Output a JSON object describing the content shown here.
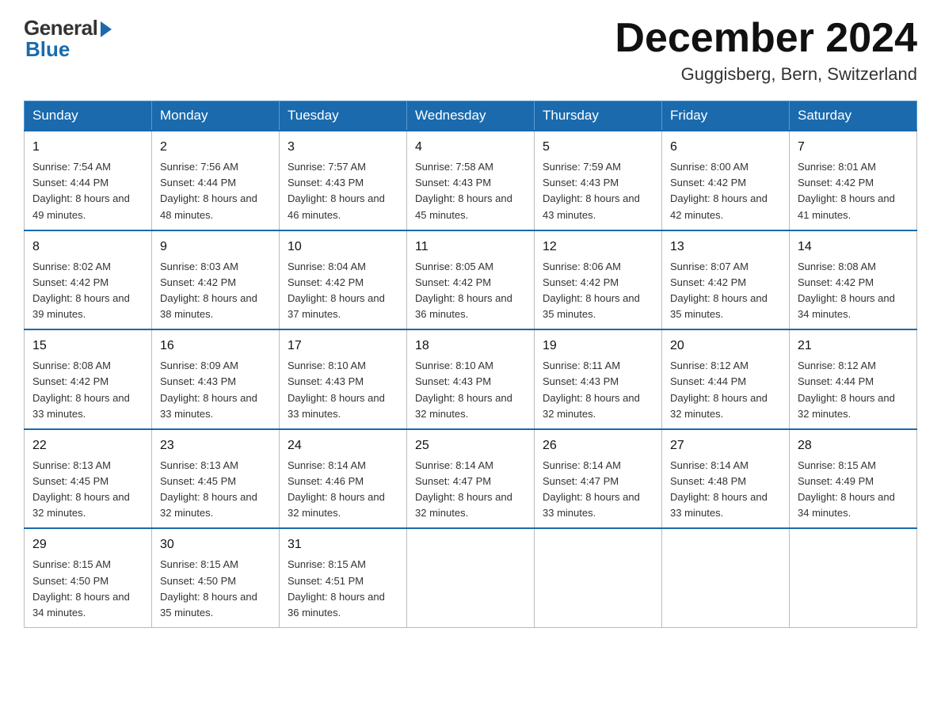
{
  "logo": {
    "general": "General",
    "blue": "Blue"
  },
  "title": {
    "month": "December 2024",
    "location": "Guggisberg, Bern, Switzerland"
  },
  "headers": [
    "Sunday",
    "Monday",
    "Tuesday",
    "Wednesday",
    "Thursday",
    "Friday",
    "Saturday"
  ],
  "weeks": [
    [
      {
        "day": "1",
        "sunrise": "7:54 AM",
        "sunset": "4:44 PM",
        "daylight": "8 hours and 49 minutes."
      },
      {
        "day": "2",
        "sunrise": "7:56 AM",
        "sunset": "4:44 PM",
        "daylight": "8 hours and 48 minutes."
      },
      {
        "day": "3",
        "sunrise": "7:57 AM",
        "sunset": "4:43 PM",
        "daylight": "8 hours and 46 minutes."
      },
      {
        "day": "4",
        "sunrise": "7:58 AM",
        "sunset": "4:43 PM",
        "daylight": "8 hours and 45 minutes."
      },
      {
        "day": "5",
        "sunrise": "7:59 AM",
        "sunset": "4:43 PM",
        "daylight": "8 hours and 43 minutes."
      },
      {
        "day": "6",
        "sunrise": "8:00 AM",
        "sunset": "4:42 PM",
        "daylight": "8 hours and 42 minutes."
      },
      {
        "day": "7",
        "sunrise": "8:01 AM",
        "sunset": "4:42 PM",
        "daylight": "8 hours and 41 minutes."
      }
    ],
    [
      {
        "day": "8",
        "sunrise": "8:02 AM",
        "sunset": "4:42 PM",
        "daylight": "8 hours and 39 minutes."
      },
      {
        "day": "9",
        "sunrise": "8:03 AM",
        "sunset": "4:42 PM",
        "daylight": "8 hours and 38 minutes."
      },
      {
        "day": "10",
        "sunrise": "8:04 AM",
        "sunset": "4:42 PM",
        "daylight": "8 hours and 37 minutes."
      },
      {
        "day": "11",
        "sunrise": "8:05 AM",
        "sunset": "4:42 PM",
        "daylight": "8 hours and 36 minutes."
      },
      {
        "day": "12",
        "sunrise": "8:06 AM",
        "sunset": "4:42 PM",
        "daylight": "8 hours and 35 minutes."
      },
      {
        "day": "13",
        "sunrise": "8:07 AM",
        "sunset": "4:42 PM",
        "daylight": "8 hours and 35 minutes."
      },
      {
        "day": "14",
        "sunrise": "8:08 AM",
        "sunset": "4:42 PM",
        "daylight": "8 hours and 34 minutes."
      }
    ],
    [
      {
        "day": "15",
        "sunrise": "8:08 AM",
        "sunset": "4:42 PM",
        "daylight": "8 hours and 33 minutes."
      },
      {
        "day": "16",
        "sunrise": "8:09 AM",
        "sunset": "4:43 PM",
        "daylight": "8 hours and 33 minutes."
      },
      {
        "day": "17",
        "sunrise": "8:10 AM",
        "sunset": "4:43 PM",
        "daylight": "8 hours and 33 minutes."
      },
      {
        "day": "18",
        "sunrise": "8:10 AM",
        "sunset": "4:43 PM",
        "daylight": "8 hours and 32 minutes."
      },
      {
        "day": "19",
        "sunrise": "8:11 AM",
        "sunset": "4:43 PM",
        "daylight": "8 hours and 32 minutes."
      },
      {
        "day": "20",
        "sunrise": "8:12 AM",
        "sunset": "4:44 PM",
        "daylight": "8 hours and 32 minutes."
      },
      {
        "day": "21",
        "sunrise": "8:12 AM",
        "sunset": "4:44 PM",
        "daylight": "8 hours and 32 minutes."
      }
    ],
    [
      {
        "day": "22",
        "sunrise": "8:13 AM",
        "sunset": "4:45 PM",
        "daylight": "8 hours and 32 minutes."
      },
      {
        "day": "23",
        "sunrise": "8:13 AM",
        "sunset": "4:45 PM",
        "daylight": "8 hours and 32 minutes."
      },
      {
        "day": "24",
        "sunrise": "8:14 AM",
        "sunset": "4:46 PM",
        "daylight": "8 hours and 32 minutes."
      },
      {
        "day": "25",
        "sunrise": "8:14 AM",
        "sunset": "4:47 PM",
        "daylight": "8 hours and 32 minutes."
      },
      {
        "day": "26",
        "sunrise": "8:14 AM",
        "sunset": "4:47 PM",
        "daylight": "8 hours and 33 minutes."
      },
      {
        "day": "27",
        "sunrise": "8:14 AM",
        "sunset": "4:48 PM",
        "daylight": "8 hours and 33 minutes."
      },
      {
        "day": "28",
        "sunrise": "8:15 AM",
        "sunset": "4:49 PM",
        "daylight": "8 hours and 34 minutes."
      }
    ],
    [
      {
        "day": "29",
        "sunrise": "8:15 AM",
        "sunset": "4:50 PM",
        "daylight": "8 hours and 34 minutes."
      },
      {
        "day": "30",
        "sunrise": "8:15 AM",
        "sunset": "4:50 PM",
        "daylight": "8 hours and 35 minutes."
      },
      {
        "day": "31",
        "sunrise": "8:15 AM",
        "sunset": "4:51 PM",
        "daylight": "8 hours and 36 minutes."
      },
      null,
      null,
      null,
      null
    ]
  ]
}
